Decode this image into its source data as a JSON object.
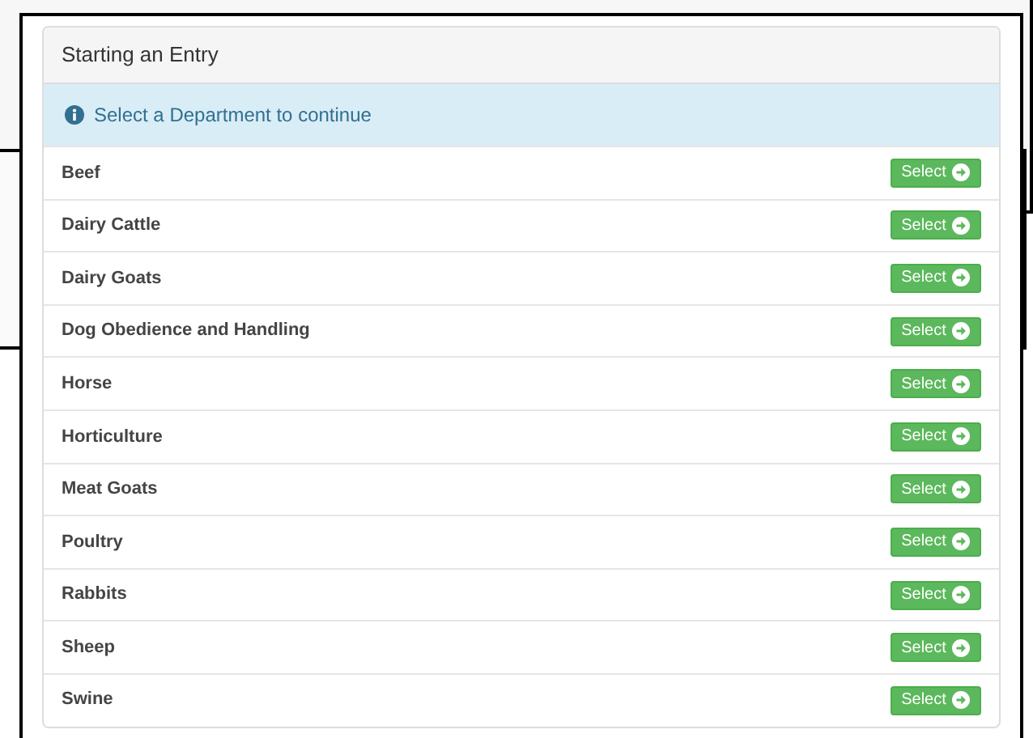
{
  "panel": {
    "title": "Starting an Entry",
    "info": "Select a Department to continue"
  },
  "departments": [
    {
      "name": "Beef",
      "button": "Select"
    },
    {
      "name": "Dairy Cattle",
      "button": "Select"
    },
    {
      "name": "Dairy Goats",
      "button": "Select"
    },
    {
      "name": "Dog Obedience and Handling",
      "button": "Select"
    },
    {
      "name": "Horse",
      "button": "Select"
    },
    {
      "name": "Horticulture",
      "button": "Select"
    },
    {
      "name": "Meat Goats",
      "button": "Select"
    },
    {
      "name": "Poultry",
      "button": "Select"
    },
    {
      "name": "Rabbits",
      "button": "Select"
    },
    {
      "name": "Sheep",
      "button": "Select"
    },
    {
      "name": "Swine",
      "button": "Select"
    }
  ]
}
